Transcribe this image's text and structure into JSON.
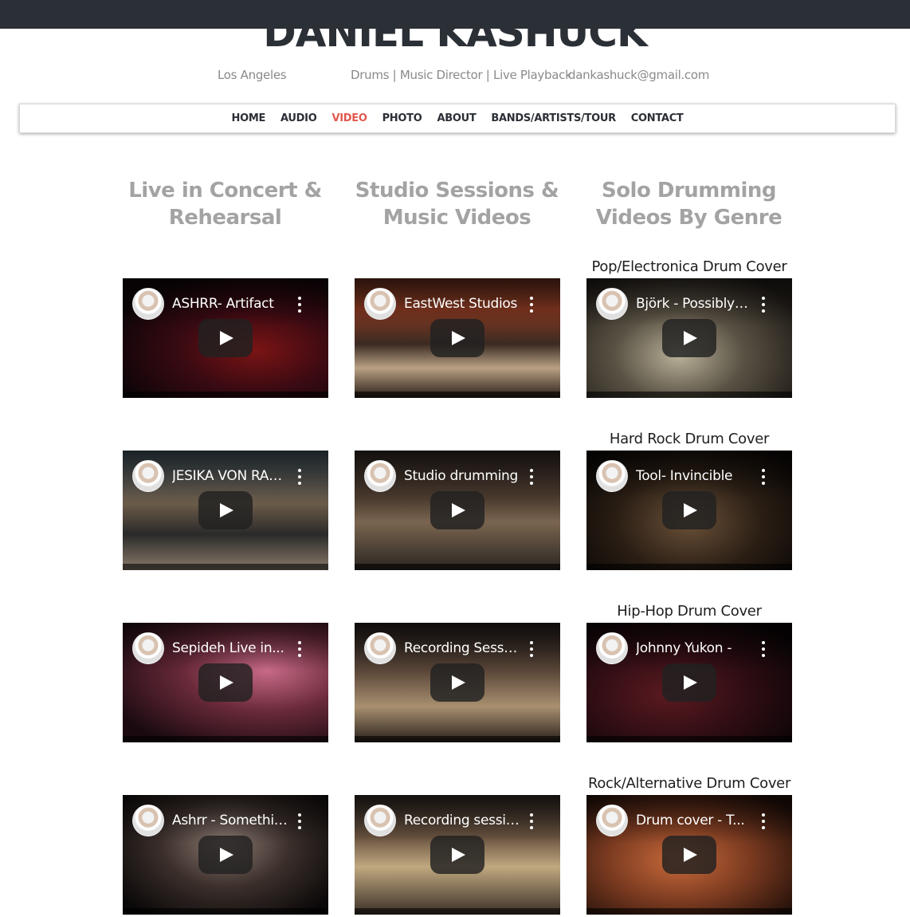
{
  "site": {
    "title": "DANIEL KASHUCK",
    "location": "Los Angeles",
    "roles": "Drums | Music Director | Live Playback",
    "email": "dankashuck@gmail.com"
  },
  "nav": {
    "items": [
      {
        "label": "HOME"
      },
      {
        "label": "AUDIO"
      },
      {
        "label": "VIDEO",
        "active": true
      },
      {
        "label": "PHOTO"
      },
      {
        "label": "ABOUT"
      },
      {
        "label": "BANDS/ARTISTS/TOUR"
      },
      {
        "label": "CONTACT"
      }
    ],
    "active_color": "#e2584d"
  },
  "columns": {
    "live": {
      "title_line1": "Live in Concert &",
      "title_line2": "Rehearsal"
    },
    "studio": {
      "title_line1": "Studio Sessions &",
      "title_line2": "Music Videos"
    },
    "solo": {
      "title_line1": "Solo Drumming",
      "title_line2": "Videos By Genre"
    }
  },
  "genres": [
    "Pop/Electronica Drum Cover",
    "Hard Rock Drum Cover",
    "Hip-Hop Drum Cover",
    "Rock/Alternative Drum Cover"
  ],
  "videos": {
    "live": [
      {
        "title": "ASHRR- Artifact"
      },
      {
        "title": "JESIKA VON RABBIT"
      },
      {
        "title": "Sepideh Live in..."
      },
      {
        "title": "Ashrr - Something"
      }
    ],
    "studio": [
      {
        "title": "EastWest Studios"
      },
      {
        "title": "Studio drumming"
      },
      {
        "title": "Recording Session"
      },
      {
        "title": "Recording session"
      }
    ],
    "solo": [
      {
        "title": "Björk - Possibly Maybe"
      },
      {
        "title": "Tool- Invincible"
      },
      {
        "title": "Johnny Yukon -"
      },
      {
        "title": "Drum cover - T..."
      }
    ]
  },
  "icons": {
    "play": "play-icon",
    "menu": "more-vert-icon",
    "avatar": "channel-avatar"
  }
}
